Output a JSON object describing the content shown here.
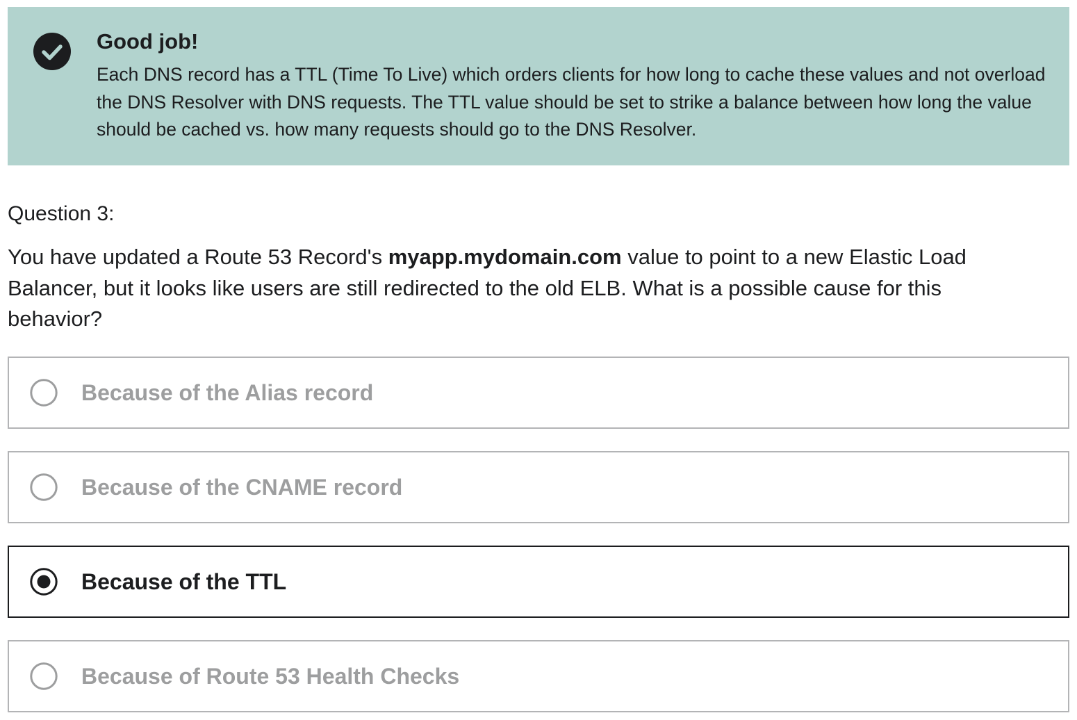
{
  "feedback": {
    "icon": "check-circle-icon",
    "title": "Good job!",
    "body": "Each DNS record has a TTL (Time To Live) which orders clients for how long to cache these values and not overload the DNS Resolver with DNS requests. The TTL value should be set to strike a balance between how long the value should be cached vs. how many requests should go to the DNS Resolver.",
    "background_color": "#b2d3ce"
  },
  "question": {
    "label": "Question 3:",
    "text_before": "You have updated a Route 53 Record's ",
    "text_bold": "myapp.mydomain.com",
    "text_after": " value to point to a new Elastic Load Balancer, but it looks like users are still redirected to the old ELB. What is a possible cause for this behavior?"
  },
  "options": [
    {
      "label": "Because of the Alias record",
      "selected": false
    },
    {
      "label": "Because of the CNAME record",
      "selected": false
    },
    {
      "label": "Because of the TTL",
      "selected": true
    },
    {
      "label": "Because of Route 53 Health Checks",
      "selected": false
    }
  ],
  "colors": {
    "text": "#1c1d1f",
    "muted_option_text": "#9d9e9f",
    "option_border": "#b3b4b6",
    "selected_border": "#1c1d1f"
  }
}
